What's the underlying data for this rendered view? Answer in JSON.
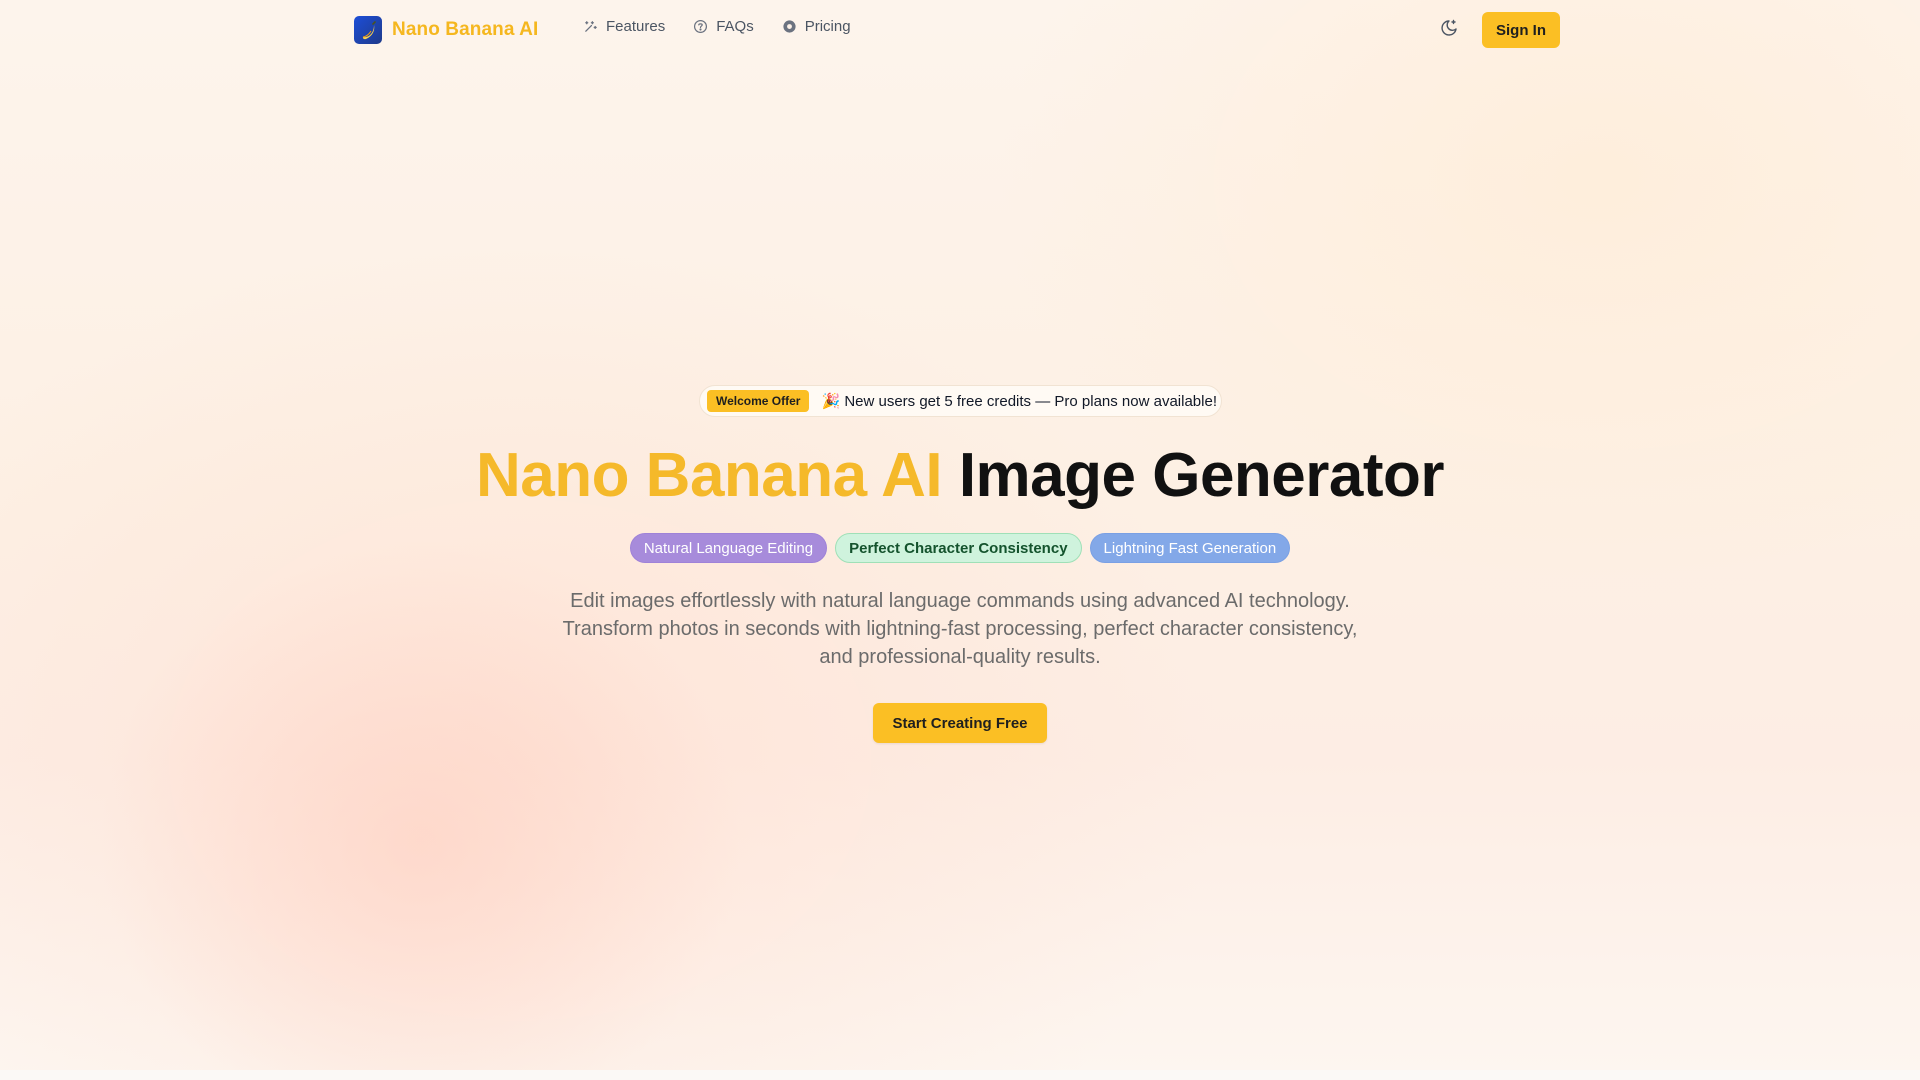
{
  "header": {
    "brand_name": "Nano Banana AI",
    "brand_color": "#f5b71f",
    "nav": [
      {
        "label": "Features",
        "icon": "sparkles-icon"
      },
      {
        "label": "FAQs",
        "icon": "help-circle-icon"
      },
      {
        "label": "Pricing",
        "icon": "coin-icon"
      }
    ],
    "theme_toggle_icon": "moon-sparkle-icon",
    "signin_label": "Sign In"
  },
  "hero": {
    "offer_badge": "Welcome Offer",
    "offer_text": "🎉 New users get 5 free credits — Pro plans now available!",
    "title_accent": "Nano Banana AI",
    "title_rest": "Image Generator",
    "tags": [
      {
        "label": "Natural Language Editing",
        "color": "#a78bdb"
      },
      {
        "label": "Perfect Character Consistency",
        "color": "#cff3dd"
      },
      {
        "label": "Lightning Fast Generation",
        "color": "#83a8e8"
      }
    ],
    "description": "Edit images effortlessly with natural language commands using advanced AI technology. Transform photos in seconds with lightning-fast processing, perfect character consistency, and professional-quality results.",
    "cta_label": "Start Creating Free"
  },
  "colors": {
    "accent": "#fbbf24"
  }
}
